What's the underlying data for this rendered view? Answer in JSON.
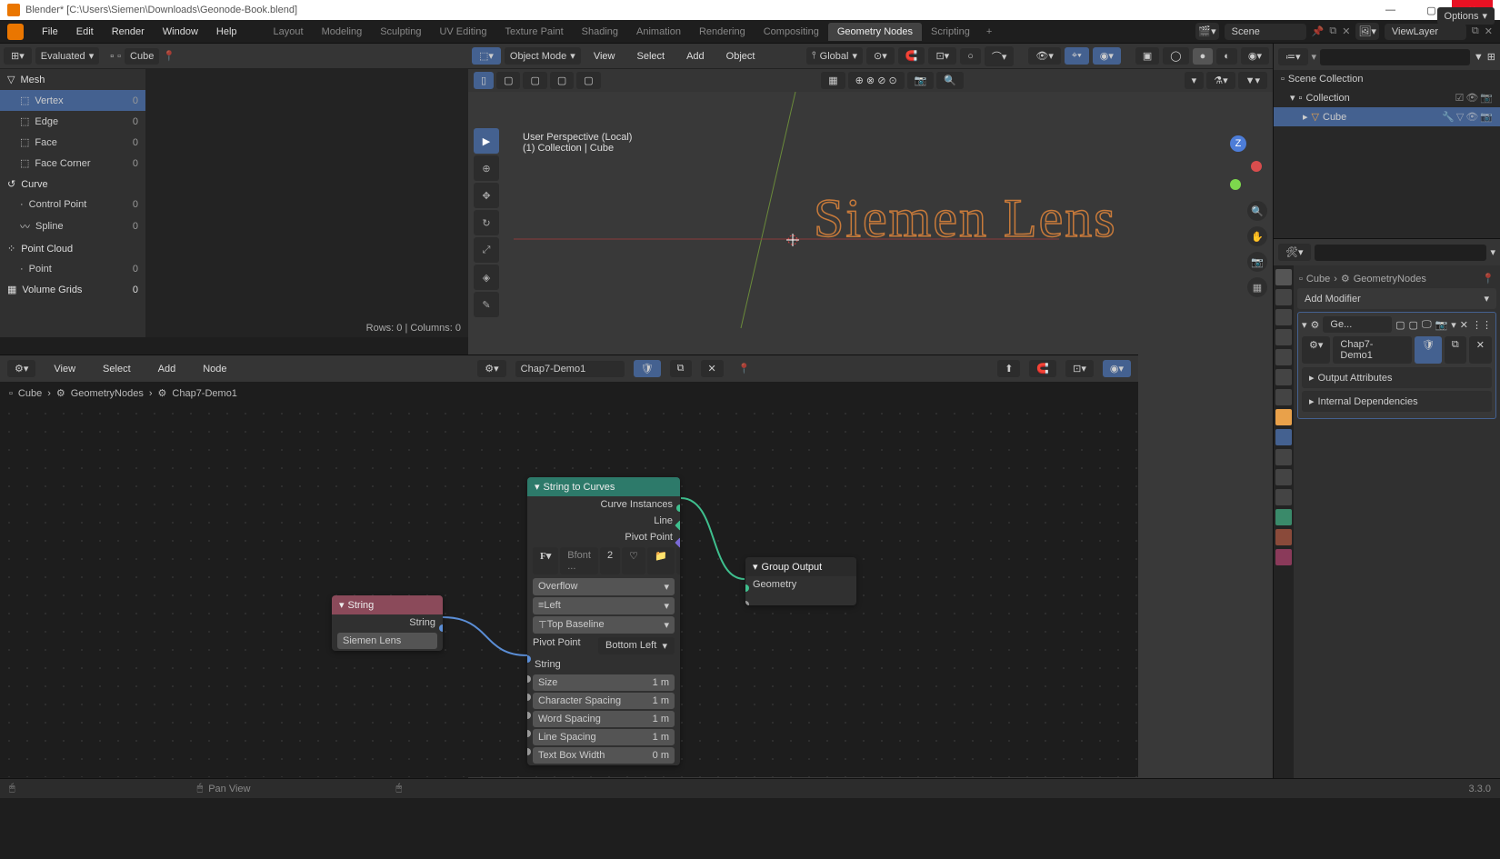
{
  "titlebar": {
    "text": "Blender* [C:\\Users\\Siemen\\Downloads\\Geonode-Book.blend]"
  },
  "menubar": {
    "items": [
      "File",
      "Edit",
      "Render",
      "Window",
      "Help"
    ],
    "workspaces": [
      "Layout",
      "Modeling",
      "Sculpting",
      "UV Editing",
      "Texture Paint",
      "Shading",
      "Animation",
      "Rendering",
      "Compositing",
      "Geometry Nodes",
      "Scripting"
    ],
    "active_ws": "Geometry Nodes",
    "scene": "Scene",
    "viewlayer": "ViewLayer"
  },
  "spreadsheet": {
    "mode": "Evaluated",
    "object": "Cube",
    "domains": {
      "mesh": {
        "label": "Mesh",
        "items": [
          {
            "label": "Vertex",
            "count": "0",
            "sel": true
          },
          {
            "label": "Edge",
            "count": "0"
          },
          {
            "label": "Face",
            "count": "0"
          },
          {
            "label": "Face Corner",
            "count": "0"
          }
        ]
      },
      "curve": {
        "label": "Curve",
        "items": [
          {
            "label": "Control Point",
            "count": "0"
          },
          {
            "label": "Spline",
            "count": "0"
          }
        ]
      },
      "pointcloud": {
        "label": "Point Cloud",
        "items": [
          {
            "label": "Point",
            "count": "0"
          }
        ]
      },
      "volume": {
        "label": "Volume Grids",
        "count": "0"
      }
    },
    "footer": "Rows: 0   |   Columns: 0"
  },
  "viewport": {
    "mode": "Object Mode",
    "menus": [
      "View",
      "Select",
      "Add",
      "Object"
    ],
    "orient": "Global",
    "info1": "User Perspective (Local)",
    "info2": "(1) Collection | Cube",
    "displayed_text": "Siemen Lens",
    "options": "Options"
  },
  "node_editor": {
    "menus": [
      "View",
      "Select",
      "Add",
      "Node"
    ],
    "tree_name": "Chap7-Demo1",
    "breadcrumb": [
      "Cube",
      "GeometryNodes",
      "Chap7-Demo1"
    ],
    "nodes": {
      "string": {
        "title": "String",
        "output": "String",
        "value": "Siemen Lens"
      },
      "s2c": {
        "title": "String to Curves",
        "outputs": [
          "Curve Instances",
          "Line",
          "Pivot Point"
        ],
        "font": "Bfont ...",
        "font_users": "2",
        "overflow": "Overflow",
        "align_h": "Left",
        "align_v": "Top Baseline",
        "pivot_label": "Pivot Point",
        "pivot": "Bottom Left",
        "string_in": "String",
        "props": [
          {
            "label": "Size",
            "value": "1 m"
          },
          {
            "label": "Character Spacing",
            "value": "1 m"
          },
          {
            "label": "Word Spacing",
            "value": "1 m"
          },
          {
            "label": "Line Spacing",
            "value": "1 m"
          },
          {
            "label": "Text Box Width",
            "value": "0 m"
          }
        ]
      },
      "group_out": {
        "title": "Group Output",
        "input": "Geometry"
      }
    }
  },
  "outliner": {
    "root": "Scene Collection",
    "collection": "Collection",
    "item": "Cube"
  },
  "properties": {
    "object": "Cube",
    "modifier": "GeometryNodes",
    "add_modifier": "Add Modifier",
    "mod_short": "Ge...",
    "tree": "Chap7-Demo1",
    "panels": [
      "Output Attributes",
      "Internal Dependencies"
    ]
  },
  "statusbar": {
    "hint": "Pan View",
    "version": "3.3.0"
  }
}
